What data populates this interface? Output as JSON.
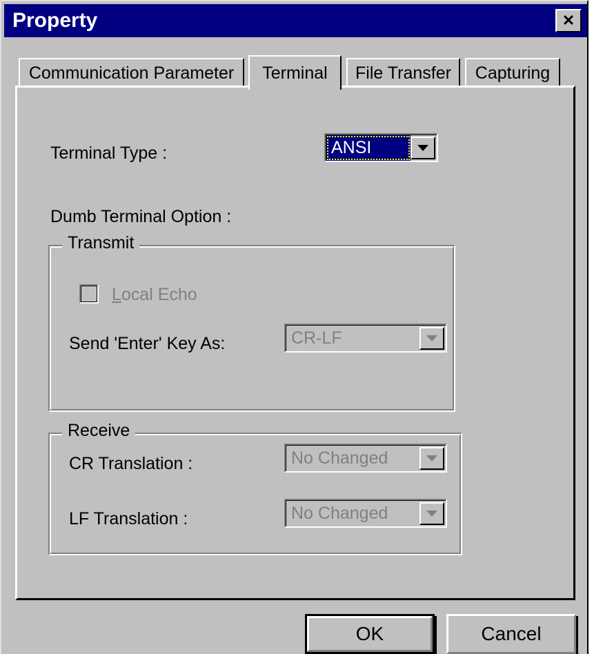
{
  "window": {
    "title": "Property",
    "close_icon": "close-x-icon"
  },
  "tabs": [
    {
      "label": "Communication Parameter",
      "active": false
    },
    {
      "label": "Terminal",
      "active": true
    },
    {
      "label": "File Transfer",
      "active": false
    },
    {
      "label": "Capturing",
      "active": false
    }
  ],
  "terminal_tab": {
    "terminal_type": {
      "label": "Terminal Type :",
      "value": "ANSI",
      "state": "focused-selected",
      "arrow_icon": "chevron-down-icon"
    },
    "dumb_terminal_option_label": "Dumb Terminal Option :",
    "transmit_group": {
      "title": "Transmit",
      "local_echo": {
        "label": "Local Echo",
        "accel": "L",
        "checked": false,
        "enabled": false
      },
      "send_enter_key": {
        "label": "Send 'Enter' Key  As:",
        "value": "CR-LF",
        "enabled": false,
        "arrow_icon": "chevron-down-icon"
      }
    },
    "receive_group": {
      "title": "Receive",
      "cr_translation": {
        "label": "CR Translation :",
        "value": "No Changed",
        "enabled": false,
        "arrow_icon": "chevron-down-icon"
      },
      "lf_translation": {
        "label": "LF Translation :",
        "value": "No Changed",
        "enabled": false,
        "arrow_icon": "chevron-down-icon"
      }
    }
  },
  "buttons": {
    "ok": "OK",
    "cancel": "Cancel"
  },
  "colors": {
    "titlebar": "#000080",
    "face": "#c0c0c0",
    "highlight": "#ffffff",
    "shadow": "#808080",
    "dark": "#000000",
    "selection": "#000080",
    "focus_dots": "#ffff00",
    "disabled_text": "#808080"
  }
}
